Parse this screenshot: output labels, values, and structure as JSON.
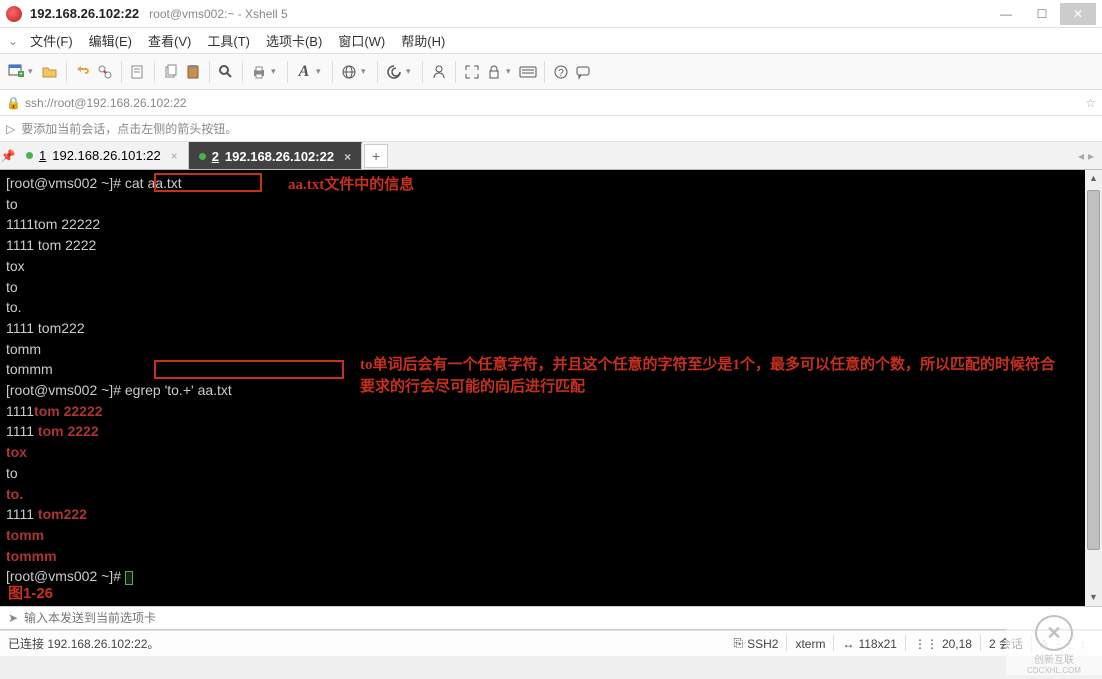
{
  "window": {
    "title_main": "192.168.26.102:22",
    "title_sub": "root@vms002:~ - Xshell 5"
  },
  "menus": {
    "file": "文件(F)",
    "edit": "编辑(E)",
    "view": "查看(V)",
    "tools": "工具(T)",
    "tabs": "选项卡(B)",
    "window": "窗口(W)",
    "help": "帮助(H)"
  },
  "address": {
    "url": "ssh://root@192.168.26.102:22"
  },
  "hint": {
    "text": "要添加当前会话，点击左侧的箭头按钮。"
  },
  "tabs": {
    "tab1": {
      "index": "1",
      "label": "192.168.26.101:22"
    },
    "tab2": {
      "index": "2",
      "label": "192.168.26.102:22"
    },
    "add": "+"
  },
  "terminal": {
    "line01_prompt": "[root@vms002 ~]# ",
    "line01_cmd": "cat aa.txt",
    "annot1": "aa.txt文件中的信息",
    "line02": "to",
    "line03": "1111tom 22222",
    "line04": "1111 tom 2222",
    "line05": "tox",
    "line06": "to",
    "line07": "to.",
    "line08": "1111 tom222",
    "line09": "tomm",
    "line10": "tommm",
    "line11_prompt": "[root@vms002 ~]# ",
    "line11_cmd": "egrep 'to.+' aa.txt",
    "annot2": "to单词后会有一个任意字符，并且这个任意的字符至少是1个，最多可以任意的个数，所以匹配的时候符合要求的行会尽可能的向后进行匹配",
    "line12_p1": "1111",
    "line12_m": "tom 22222",
    "line13_p1": "1111 ",
    "line13_m": "tom 2222",
    "line14_m": "tox",
    "line15_p1": "to",
    "line16_m": "to.",
    "line17_p1": "1111 ",
    "line17_m": "tom222",
    "line18_m": "tomm",
    "line19_m": "tommm",
    "line20_prompt": "[root@vms002 ~]# ",
    "figlabel": "图1-26"
  },
  "inputbar": {
    "placeholder": "输入本发送到当前选项卡"
  },
  "status": {
    "conn": "已连接 192.168.26.102:22。",
    "ssh": "SSH2",
    "term": "xterm",
    "size": "118x21",
    "pos": "20,18",
    "sess": "2 会话"
  },
  "watermark": {
    "brand": "创新互联",
    "domain": "CDCXHL.COM"
  }
}
